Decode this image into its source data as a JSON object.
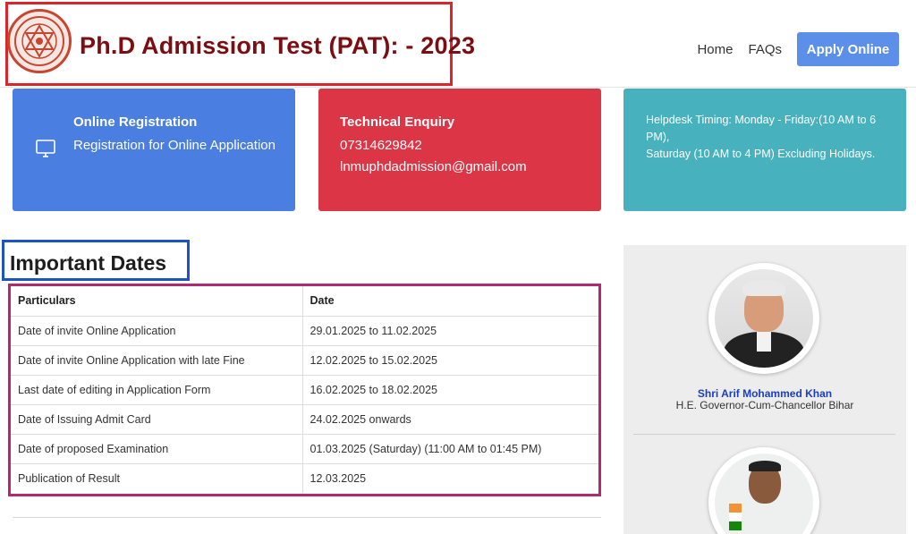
{
  "header": {
    "title": "Ph.D Admission Test (PAT): - 2023",
    "logo_icon": "university-emblem-icon",
    "nav": {
      "home": "Home",
      "faqs": "FAQs",
      "apply": "Apply Online"
    }
  },
  "cards": {
    "registration": {
      "title": "Online Registration",
      "text": "Registration for Online Application",
      "icon": "monitor-icon",
      "color": "#4a7ee0"
    },
    "enquiry": {
      "title": "Technical Enquiry",
      "phone": "07314629842",
      "email": "lnmuphdadmission@gmail.com",
      "color": "#dc3545"
    },
    "helpdesk": {
      "text": "Helpdesk Timing: Monday - Friday:(10 AM to 6 PM),\nSaturday (10 AM to 4 PM) Excluding Holidays.",
      "color": "#47b1bd"
    }
  },
  "important_dates": {
    "heading": "Important Dates",
    "columns": [
      "Particulars",
      "Date"
    ],
    "rows": [
      [
        "Date of invite Online Application",
        "29.01.2025 to 11.02.2025"
      ],
      [
        "Date of invite Online Application with late Fine",
        "12.02.2025 to 15.02.2025"
      ],
      [
        "Last date of editing in Application Form",
        "16.02.2025 to 18.02.2025"
      ],
      [
        "Date of Issuing Admit Card",
        "24.02.2025 onwards"
      ],
      [
        "Date of proposed Examination",
        "01.03.2025 (Saturday) (11:00 AM to 01:45 PM)"
      ],
      [
        "Publication of Result",
        "12.03.2025"
      ]
    ]
  },
  "side_panel": {
    "person1": {
      "name": "Shri Arif Mohammed Khan",
      "role": "H.E. Governor-Cum-Chancellor Bihar"
    }
  },
  "colors": {
    "title_dark_red": "#7a0e12",
    "highlight_red": "#d9262b",
    "highlight_blue": "#1c54c8",
    "highlight_magenta": "#b5286f",
    "apply_button": "#5b8fe8"
  }
}
